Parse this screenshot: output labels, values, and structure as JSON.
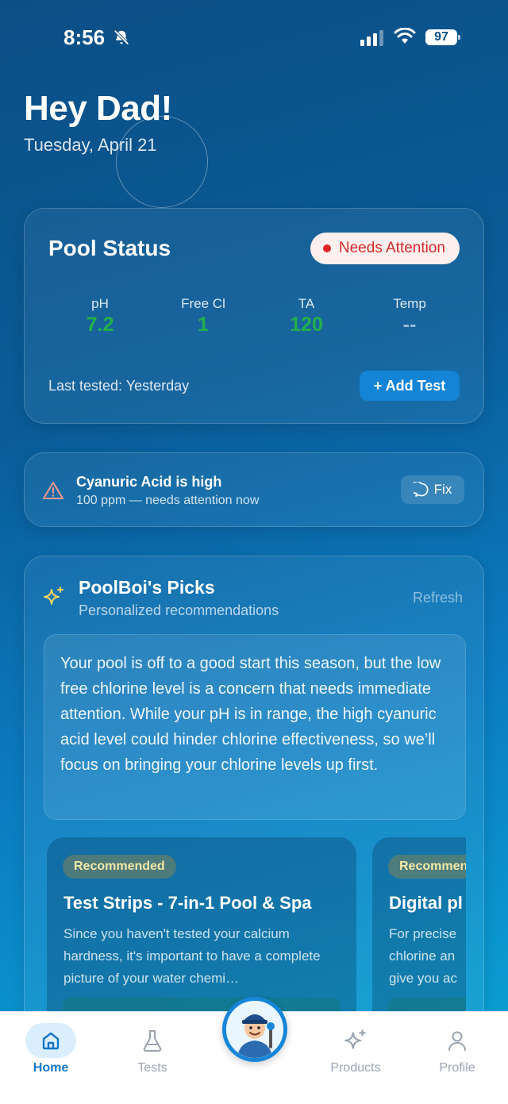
{
  "status_bar": {
    "time": "8:56",
    "battery": "97"
  },
  "header": {
    "greeting": "Hey Dad!",
    "date": "Tuesday, April 21"
  },
  "pool_status": {
    "title": "Pool Status",
    "badge": "Needs Attention",
    "metrics": [
      {
        "label": "pH",
        "value": "7.2"
      },
      {
        "label": "Free Cl",
        "value": "1"
      },
      {
        "label": "TA",
        "value": "120"
      },
      {
        "label": "Temp",
        "value": "--"
      }
    ],
    "last_tested": "Last tested: Yesterday",
    "add_test_label": "+ Add Test"
  },
  "alert": {
    "title": "Cyanuric Acid is high",
    "subtitle": "100 ppm — needs attention now",
    "fix_label": "Fix"
  },
  "picks": {
    "title": "PoolBoi's Picks",
    "subtitle": "Personalized recommendations",
    "refresh_label": "Refresh",
    "summary": "Your pool is off to a good start this season, but the low free chlorine level is a concern that needs immediate attention. While your pH is in range, the high cyanuric acid level could hinder chlorine effectiveness, so we’ll focus on bringing your chlorine levels up first.",
    "cards": [
      {
        "badge": "Recommended",
        "title": "Test Strips - 7-in-1 Pool & Spa",
        "description": "Since you haven't tested your calcium hardness, it's important to have a complete picture of your water chemi…"
      },
      {
        "badge": "Recommended",
        "title": "Digital pl",
        "description": "For precise chlorine an give you ac"
      }
    ]
  },
  "tab_bar": {
    "tabs": [
      {
        "label": "Home",
        "icon": "home-icon"
      },
      {
        "label": "Tests",
        "icon": "flask-icon"
      },
      {
        "label": "Products",
        "icon": "sparkle-icon"
      },
      {
        "label": "Profile",
        "icon": "person-icon"
      }
    ],
    "active": "Home",
    "accent_color": "#1476c8"
  },
  "colors": {
    "good": "#22b04b",
    "alert": "#e02424"
  }
}
